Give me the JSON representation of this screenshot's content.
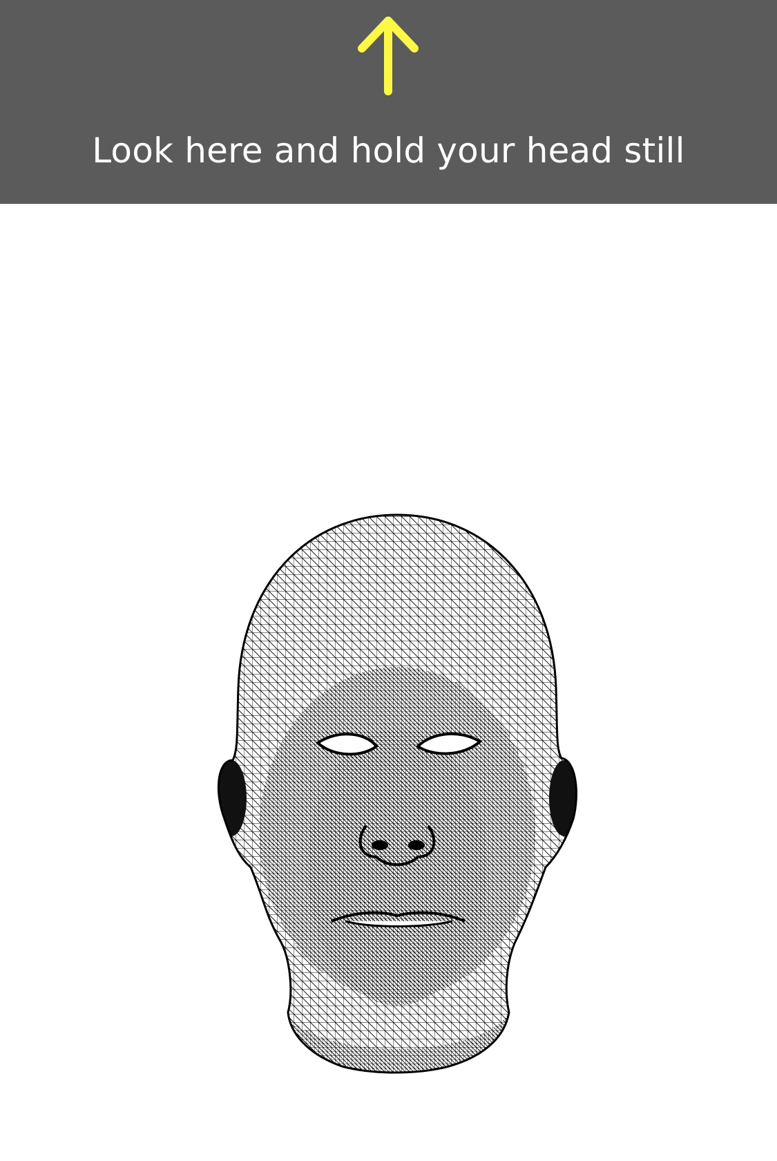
{
  "banner": {
    "instruction": "Look here and hold your head still",
    "arrow_icon": "arrow-up-icon",
    "arrow_color": "#fdf845",
    "background_color": "#5b5b5b"
  },
  "face_mesh": {
    "icon": "face-mesh-wireframe-icon"
  }
}
